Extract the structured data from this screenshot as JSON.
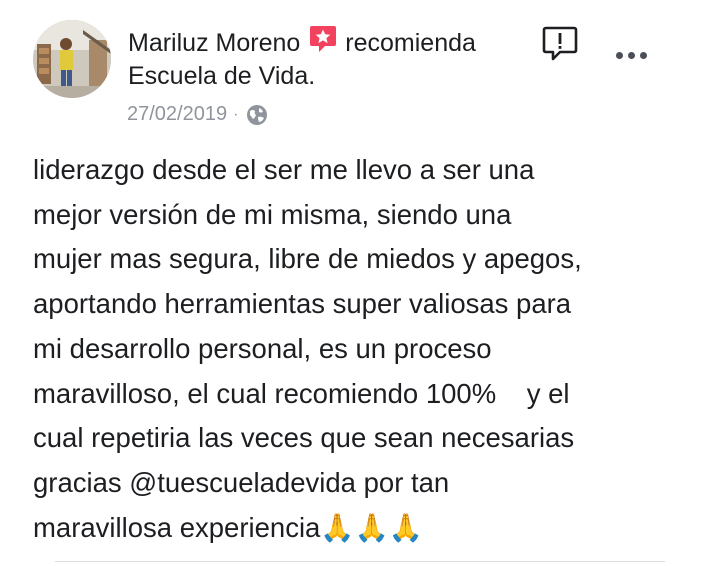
{
  "post": {
    "author": "Mariluz Moreno",
    "action": "recomienda",
    "page_name": "Escuela de Vida.",
    "date": "27/02/2019",
    "separator": "·",
    "privacy_icon": "globe-icon",
    "recommend_icon": "recommend-badge-icon",
    "report_icon": "report-icon",
    "more_icon": "more-options-icon",
    "lines": [
      "liderazgo desde el ser me llevo a ser una",
      "mejor versión de mi misma, siendo una",
      "mujer mas segura, libre de miedos y apegos,",
      "aportando herramientas super valiosas para",
      "mi desarrollo personal, es un proceso",
      "maravilloso, el cual recomiendo 100%    y el",
      "cual repetiria las veces que sean necesarias",
      "gracias @tuescueladevida por tan",
      "maravillosa experiencia🙏🙏🙏"
    ]
  },
  "colors": {
    "text": "#1c1e21",
    "meta": "#90949c",
    "recommend_badge": "#f3425f",
    "divider": "#dadde1"
  }
}
